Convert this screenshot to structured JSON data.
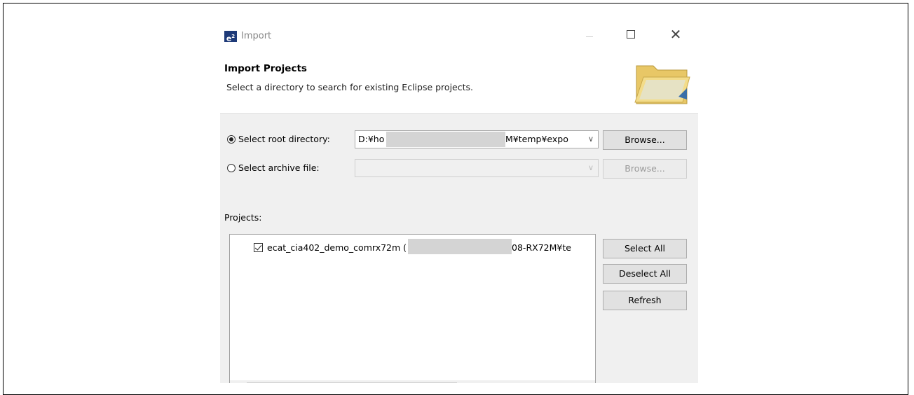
{
  "window": {
    "app_icon": "e²",
    "title": "Import",
    "controls": {
      "minimize": "—",
      "maximize": "☐",
      "close": "✕"
    }
  },
  "header": {
    "title": "Import Projects",
    "description": "Select a directory to search for existing Eclipse projects."
  },
  "source": {
    "root_label": "Select root directory:",
    "root_value_start": "D:¥ho",
    "root_value_end": "M¥temp¥expo",
    "root_selected": true,
    "archive_label": "Select archive file:",
    "archive_value": "",
    "browse_label": "Browse...",
    "browse_archive_label": "Browse..."
  },
  "projects": {
    "label": "Projects:",
    "items": [
      {
        "name_start": "ecat_cia402_demo_comrx72m (",
        "name_end": "08-RX72M¥te",
        "checked": true
      }
    ]
  },
  "actions": {
    "select_all": "Select All",
    "deselect_all": "Deselect All",
    "refresh": "Refresh"
  },
  "scrollbar": {
    "left_arrow": "<",
    "right_arrow": ">"
  }
}
